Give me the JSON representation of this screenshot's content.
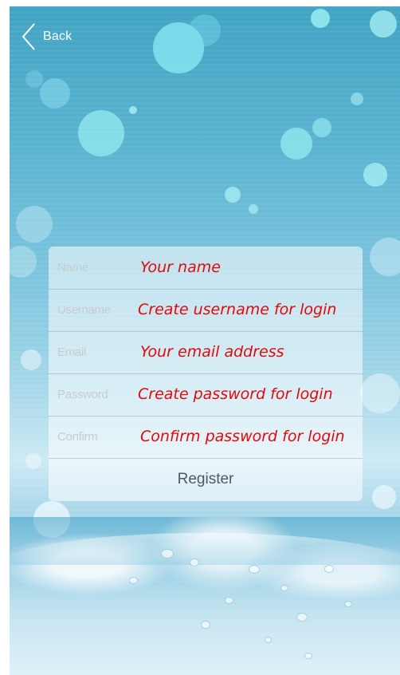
{
  "header": {
    "back_label": "Back"
  },
  "form": {
    "fields": [
      {
        "label": "Name",
        "placeholder": "Your name"
      },
      {
        "label": "Username",
        "placeholder": "Create username for login"
      },
      {
        "label": "Email",
        "placeholder": "Your email address"
      },
      {
        "label": "Password",
        "placeholder": "Create password for login"
      },
      {
        "label": "Confirm",
        "placeholder": "Confirm password for login"
      }
    ],
    "register_label": "Register"
  },
  "colors": {
    "background_top": "#3fa3c2",
    "background_mid": "#a9d9ea",
    "hint_text": "#e3070d",
    "label_text": "#c6cdd1",
    "register_text": "#4e5a62"
  },
  "icons": {
    "back": "chevron-left-icon"
  }
}
